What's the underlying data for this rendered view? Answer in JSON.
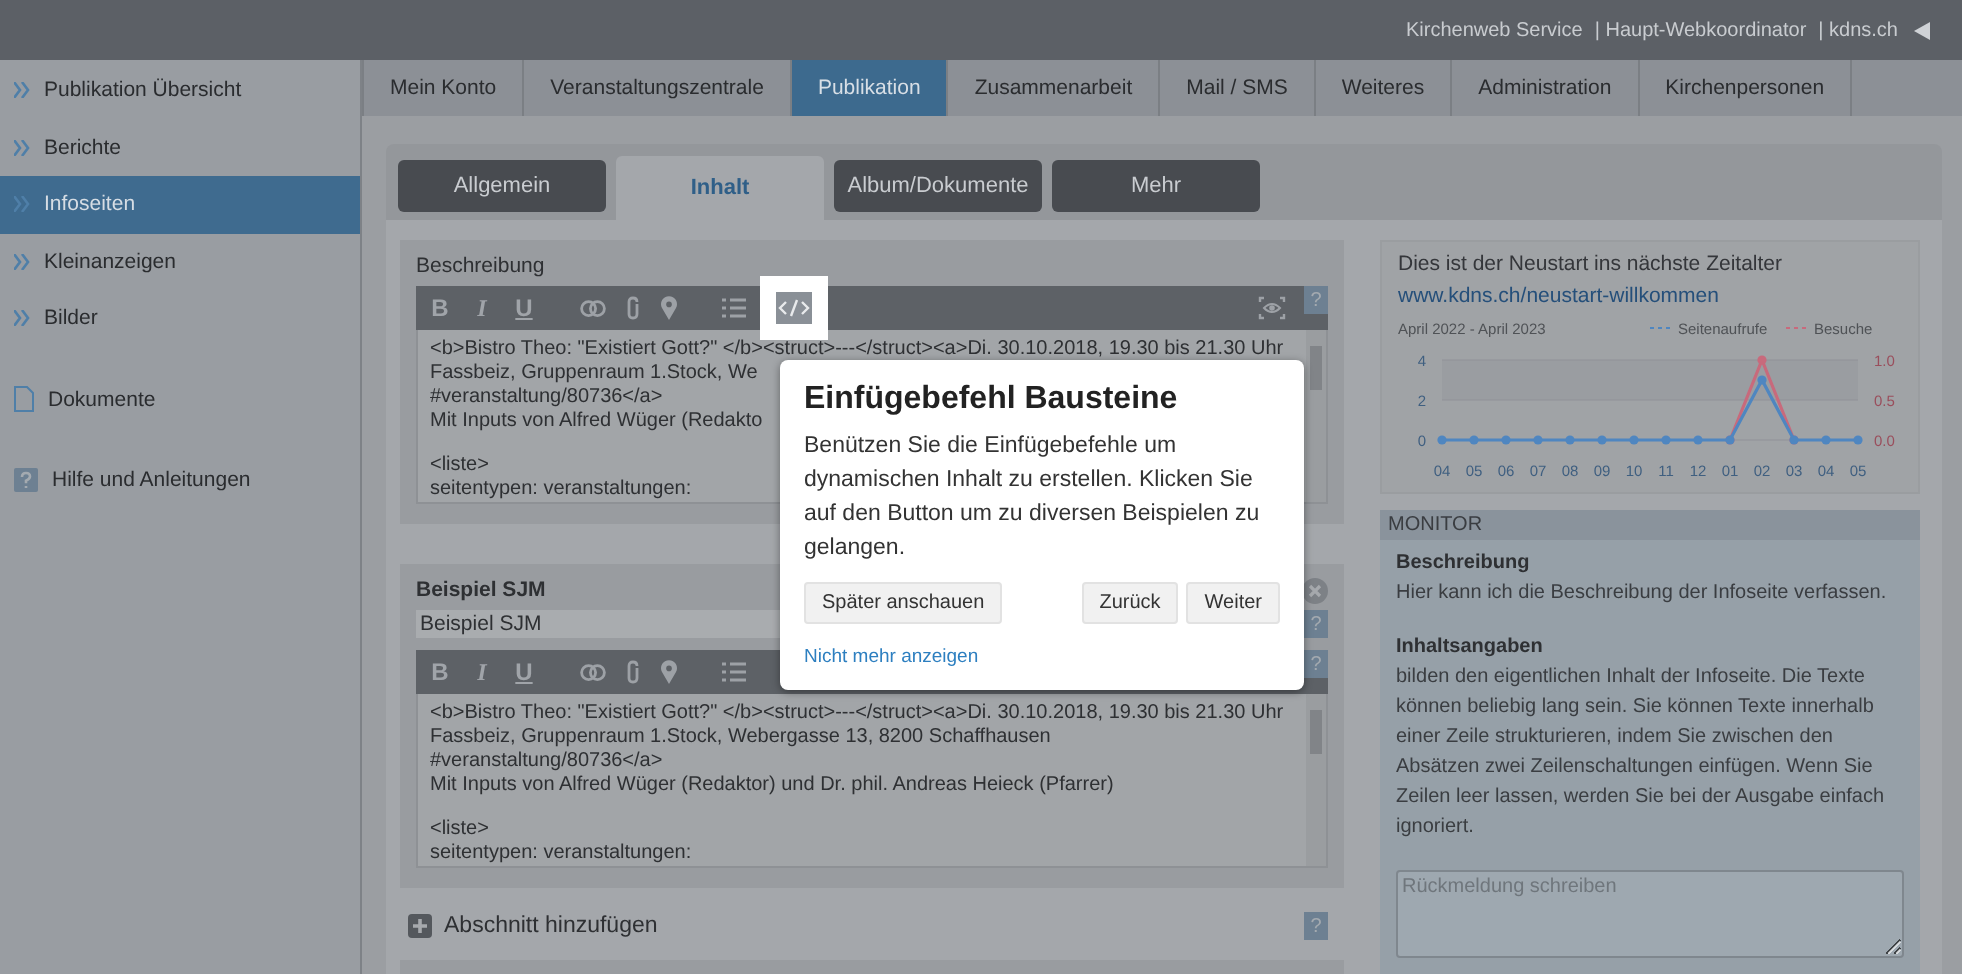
{
  "topbar": {
    "links": [
      "Kirchenweb Service",
      "| Haupt-Webkoordinator",
      "| kdns.ch"
    ]
  },
  "sidebar": {
    "items": [
      {
        "label": "Publikation Übersicht",
        "kind": "page",
        "selected": false
      },
      {
        "label": "Berichte",
        "kind": "page",
        "selected": false
      },
      {
        "label": "Infoseiten",
        "kind": "page",
        "selected": true
      },
      {
        "label": "Kleinanzeigen",
        "kind": "page",
        "selected": false
      },
      {
        "label": "Bilder",
        "kind": "page",
        "selected": false
      },
      {
        "label": "Dokumente",
        "kind": "doc",
        "selected": false
      },
      {
        "label": "Hilfe und Anleitungen",
        "kind": "help",
        "selected": false
      }
    ]
  },
  "nav_tabs": [
    {
      "label": "Mein Konto",
      "selected": false
    },
    {
      "label": "Veranstaltungszentrale",
      "selected": false
    },
    {
      "label": "Publikation",
      "selected": true
    },
    {
      "label": "Zusammenarbeit",
      "selected": false
    },
    {
      "label": "Mail / SMS",
      "selected": false
    },
    {
      "label": "Weiteres",
      "selected": false
    },
    {
      "label": "Administration",
      "selected": false
    },
    {
      "label": "Kirchenpersonen",
      "selected": false
    }
  ],
  "sub_tabs": [
    {
      "label": "Allgemein",
      "selected": false
    },
    {
      "label": "Inhalt",
      "selected": true
    },
    {
      "label": "Album/Dokumente",
      "selected": false
    },
    {
      "label": "Mehr",
      "selected": false
    }
  ],
  "sections": [
    {
      "label": "Beschreibung",
      "help": "?",
      "format_buttons": [
        "B",
        "I",
        "U"
      ],
      "code_button": {
        "highlighted": true
      },
      "preview_button": true,
      "blocks": [
        [
          "<b>Bistro Theo: \"Existiert Gott?\" </b><struct>---</struct><a>Di. 30.10.2018, 19.30 bis 21.30 Uhr",
          "Fassbeiz, Gruppenraum 1.Stock, We",
          " #veranstaltung/80736</a>",
          "Mit Inputs von Alfred Wüger (Redakto"
        ],
        [
          "<liste>",
          "seitentypen: veranstaltungen:"
        ]
      ]
    },
    {
      "title": "Beispiel SJM",
      "input_value": "Beispiel SJM",
      "input_help": "?",
      "help": "?",
      "format_buttons": [
        "B",
        "I",
        "U"
      ],
      "blocks": [
        [
          "<b>Bistro Theo: \"Existiert Gott?\" </b><struct>---</struct><a>Di. 30.10.2018, 19.30 bis 21.30 Uhr",
          "Fassbeiz, Gruppenraum 1.Stock, Webergasse 13, 8200 Schaffhausen",
          " #veranstaltung/80736</a>",
          "Mit Inputs von Alfred Wüger (Redaktor) und Dr. phil. Andreas Heieck (Pfarrer)"
        ],
        [
          "<liste>",
          "seitentypen: veranstaltungen:"
        ]
      ]
    }
  ],
  "add_section": {
    "label": "Abschnitt hinzufügen",
    "help": "?"
  },
  "preview": {
    "title": "Dies ist der Neustart ins nächste Zeitalter",
    "link": "www.kdns.ch/neustart-willkommen",
    "chart_data": {
      "type": "line",
      "title": "April 2022 - April 2023",
      "categories": [
        "04",
        "05",
        "06",
        "07",
        "08",
        "09",
        "10",
        "11",
        "12",
        "01",
        "02",
        "03",
        "04",
        "05"
      ],
      "series": [
        {
          "name": "Seitenaufrufe",
          "color": "#4f86c0",
          "marker": "circle",
          "values": [
            0,
            0,
            0,
            0,
            0,
            0,
            0,
            0,
            0,
            0,
            3,
            0,
            0,
            0
          ]
        },
        {
          "name": "Besuche",
          "color": "#c86a7c",
          "axis": "y2",
          "marker": "circle",
          "values": [
            null,
            null,
            null,
            null,
            null,
            null,
            null,
            null,
            null,
            0,
            1,
            0,
            null,
            null
          ]
        }
      ],
      "legend": "top-right",
      "bands": [
        {
          "axis": "y",
          "from": 2,
          "to": 4
        }
      ],
      "ylim": [
        0,
        4
      ],
      "yticks": [
        0,
        2,
        4
      ],
      "y2lim": [
        0,
        1
      ],
      "y2ticks": [
        {
          "value": 0,
          "label": "0.0"
        },
        {
          "value": 0.5,
          "label": "0.5"
        },
        {
          "value": 1,
          "label": "1.0"
        }
      ]
    }
  },
  "monitor": {
    "header": "MONITOR",
    "paragraphs": [
      {
        "kind": "heading",
        "text": "Beschreibung"
      },
      {
        "kind": "text",
        "text": "Hier kann ich die Beschreibung der Infoseite verfassen."
      },
      {
        "kind": "heading",
        "text": "Inhaltsangaben"
      },
      {
        "kind": "text",
        "text": "bilden den eigentlichen Inhalt der Infoseite. Die Texte können beliebig lang sein. Sie können Texte innerhalb einer Zeile strukturieren, indem Sie zwischen den Absätzen zwei Zeilenschaltungen einfügen. Wenn Sie Zeilen leer lassen, werden Sie bei der Ausgabe einfach ignoriert."
      }
    ],
    "feedback_placeholder": "Rückmeldung schreiben"
  },
  "tour": {
    "title": "Einfügebefehl Bausteine",
    "text": "Benützen Sie die Einfügebefehle um dynamischen Inhalt zu erstellen. Klicken Sie auf den Button um zu diversen Beispielen zu gelangen.",
    "later": "Später anschauen",
    "back": "Zurück",
    "next": "Weiter",
    "dismiss": "Nicht mehr anzeigen"
  }
}
